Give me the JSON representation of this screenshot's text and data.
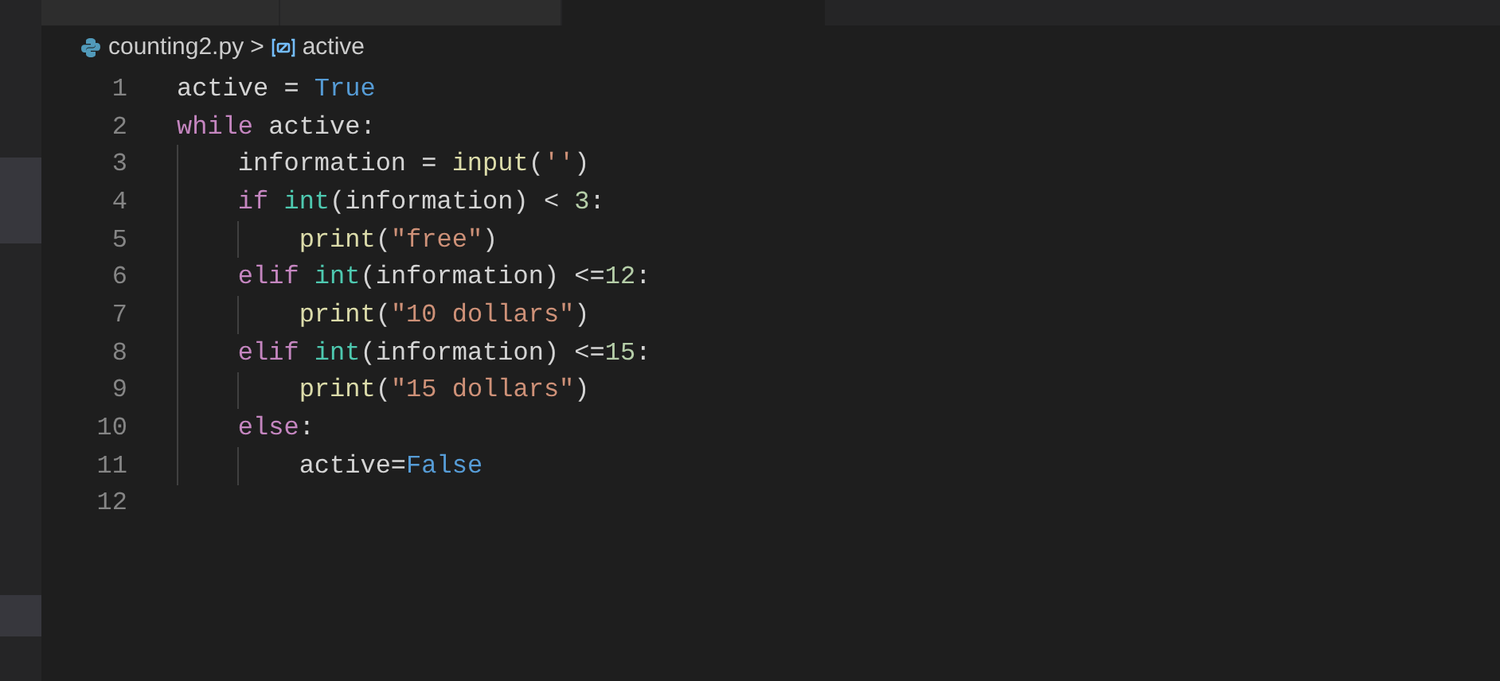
{
  "tabs": [
    {
      "selected": false
    },
    {
      "selected": false
    },
    {
      "selected": true
    }
  ],
  "breadcrumb": {
    "file": "counting2.py",
    "separator": ">",
    "symbol": "active"
  },
  "code": [
    {
      "number": "1",
      "tokens": [
        {
          "kind": "plain",
          "text": "active = "
        },
        {
          "kind": "constant",
          "text": "True"
        }
      ]
    },
    {
      "number": "2",
      "tokens": [
        {
          "kind": "keyword",
          "text": "while"
        },
        {
          "kind": "plain",
          "text": " active:"
        }
      ]
    },
    {
      "number": "3",
      "tokens": [
        {
          "kind": "plain",
          "text": "    information = "
        },
        {
          "kind": "function",
          "text": "input"
        },
        {
          "kind": "plain",
          "text": "("
        },
        {
          "kind": "string",
          "text": "''"
        },
        {
          "kind": "plain",
          "text": ")"
        }
      ]
    },
    {
      "number": "4",
      "tokens": [
        {
          "kind": "keyword",
          "text": "    if "
        },
        {
          "kind": "type",
          "text": "int"
        },
        {
          "kind": "plain",
          "text": "(information) < "
        },
        {
          "kind": "number",
          "text": "3"
        },
        {
          "kind": "plain",
          "text": ":"
        }
      ]
    },
    {
      "number": "5",
      "tokens": [
        {
          "kind": "function",
          "text": "        print"
        },
        {
          "kind": "plain",
          "text": "("
        },
        {
          "kind": "string",
          "text": "\"free\""
        },
        {
          "kind": "plain",
          "text": ")"
        }
      ]
    },
    {
      "number": "6",
      "tokens": [
        {
          "kind": "keyword",
          "text": "    elif "
        },
        {
          "kind": "type",
          "text": "int"
        },
        {
          "kind": "plain",
          "text": "(information) <="
        },
        {
          "kind": "number",
          "text": "12"
        },
        {
          "kind": "plain",
          "text": ":"
        }
      ]
    },
    {
      "number": "7",
      "tokens": [
        {
          "kind": "function",
          "text": "        print"
        },
        {
          "kind": "plain",
          "text": "("
        },
        {
          "kind": "string",
          "text": "\"10 dollars\""
        },
        {
          "kind": "plain",
          "text": ")"
        }
      ]
    },
    {
      "number": "8",
      "tokens": [
        {
          "kind": "keyword",
          "text": "    elif "
        },
        {
          "kind": "type",
          "text": "int"
        },
        {
          "kind": "plain",
          "text": "(information) <="
        },
        {
          "kind": "number",
          "text": "15"
        },
        {
          "kind": "plain",
          "text": ":"
        }
      ]
    },
    {
      "number": "9",
      "tokens": [
        {
          "kind": "function",
          "text": "        print"
        },
        {
          "kind": "plain",
          "text": "("
        },
        {
          "kind": "string",
          "text": "\"15 dollars\""
        },
        {
          "kind": "plain",
          "text": ")"
        }
      ]
    },
    {
      "number": "10",
      "tokens": [
        {
          "kind": "keyword",
          "text": "    else"
        },
        {
          "kind": "plain",
          "text": ":"
        }
      ]
    },
    {
      "number": "11",
      "tokens": [
        {
          "kind": "plain",
          "text": "        active="
        },
        {
          "kind": "constant",
          "text": "False"
        }
      ]
    },
    {
      "number": "12"
    }
  ]
}
